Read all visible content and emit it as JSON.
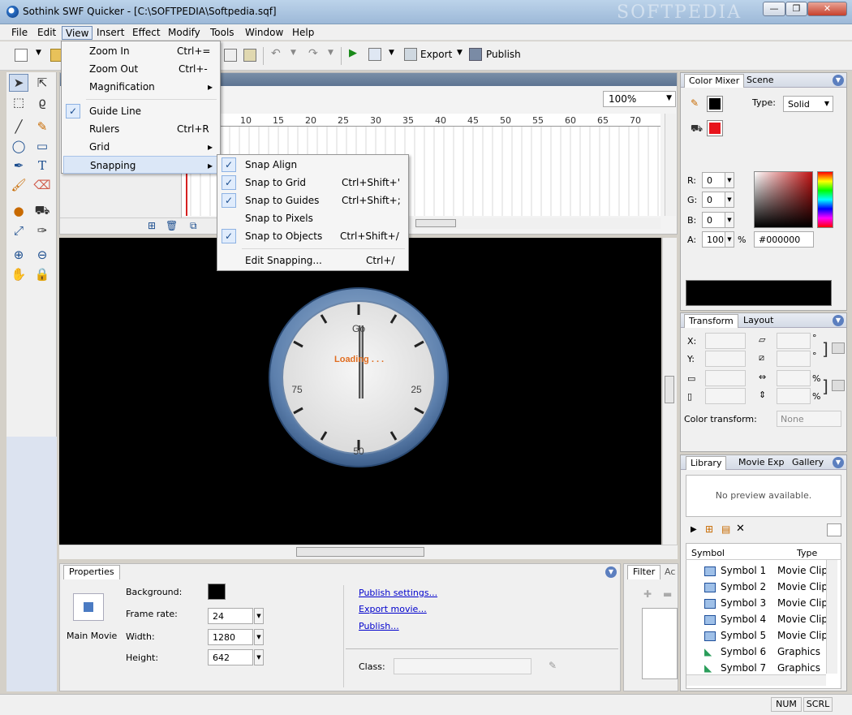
{
  "window": {
    "title": "Sothink SWF Quicker - [C:\\SOFTPEDIA\\Softpedia.sqf]",
    "watermark": "SOFTPEDIA",
    "min_label": "—",
    "max_label": "❐",
    "close_label": "✕"
  },
  "menubar": [
    "File",
    "Edit",
    "View",
    "Insert",
    "Effect",
    "Modify",
    "Tools",
    "Window",
    "Help"
  ],
  "toolbar": {
    "export_label": "Export",
    "publish_label": "Publish"
  },
  "view_menu": {
    "items": [
      {
        "label": "Zoom In",
        "shortcut": "Ctrl+="
      },
      {
        "label": "Zoom Out",
        "shortcut": "Ctrl+-"
      },
      {
        "label": "Magnification",
        "shortcut": "▸"
      },
      {
        "label": "Guide Line",
        "shortcut": "",
        "checked": true
      },
      {
        "label": "Rulers",
        "shortcut": "Ctrl+R"
      },
      {
        "label": "Grid",
        "shortcut": "▸"
      },
      {
        "label": "Snapping",
        "shortcut": "▸"
      }
    ]
  },
  "snap_menu": {
    "items": [
      {
        "label": "Snap Align",
        "shortcut": "",
        "checked": true
      },
      {
        "label": "Snap to Grid",
        "shortcut": "Ctrl+Shift+'",
        "checked": true
      },
      {
        "label": "Snap to Guides",
        "shortcut": "Ctrl+Shift+;",
        "checked": true
      },
      {
        "label": "Snap to Pixels",
        "shortcut": "",
        "checked": false
      },
      {
        "label": "Snap to Objects",
        "shortcut": "Ctrl+Shift+/",
        "checked": true
      },
      {
        "label": "Edit Snapping...",
        "shortcut": "Ctrl+/"
      }
    ]
  },
  "timeline": {
    "zoom": "100%",
    "ruler": [
      "10",
      "15",
      "20",
      "25",
      "30",
      "35",
      "40",
      "45",
      "50",
      "55",
      "60",
      "65",
      "70"
    ]
  },
  "stage": {
    "gauge": {
      "top": "Go",
      "right": "25",
      "bottom": "50",
      "left": "75",
      "loading": "Loading . . ."
    }
  },
  "properties": {
    "tab": "Properties",
    "object": "Main Movie",
    "background_label": "Background:",
    "frame_rate_label": "Frame rate:",
    "frame_rate": "24",
    "width_label": "Width:",
    "width": "1280",
    "height_label": "Height:",
    "height": "642",
    "links": [
      "Publish settings...",
      "Export movie...",
      "Publish..."
    ],
    "class_label": "Class:"
  },
  "filter": {
    "tab": "Filter",
    "tab2": "Ac"
  },
  "color_mixer": {
    "tabs": [
      "Color Mixer",
      "Scene"
    ],
    "type_label": "Type:",
    "type": "Solid",
    "r_label": "R:",
    "r": "0",
    "g_label": "G:",
    "g": "0",
    "b_label": "B:",
    "b": "0",
    "a_label": "A:",
    "a": "100",
    "pct": "%",
    "hex": "#000000",
    "fill_color": "#e8141c"
  },
  "transform": {
    "tabs": [
      "Transform",
      "Layout"
    ],
    "x_label": "X:",
    "y_label": "Y:",
    "deg": "°",
    "pct": "%",
    "color_transform_label": "Color transform:",
    "color_transform": "None"
  },
  "library": {
    "tabs": [
      "Library",
      "Movie Exp",
      "Gallery"
    ],
    "preview": "No preview available.",
    "col_symbol": "Symbol",
    "col_type": "Type",
    "symbols": [
      {
        "name": "Symbol 1",
        "type": "Movie Clip"
      },
      {
        "name": "Symbol 2",
        "type": "Movie Clip"
      },
      {
        "name": "Symbol 3",
        "type": "Movie Clip"
      },
      {
        "name": "Symbol 4",
        "type": "Movie Clip"
      },
      {
        "name": "Symbol 5",
        "type": "Movie Clip"
      },
      {
        "name": "Symbol 6",
        "type": "Graphics"
      },
      {
        "name": "Symbol 7",
        "type": "Graphics"
      }
    ]
  },
  "status": {
    "num": "NUM",
    "scrl": "SCRL"
  }
}
